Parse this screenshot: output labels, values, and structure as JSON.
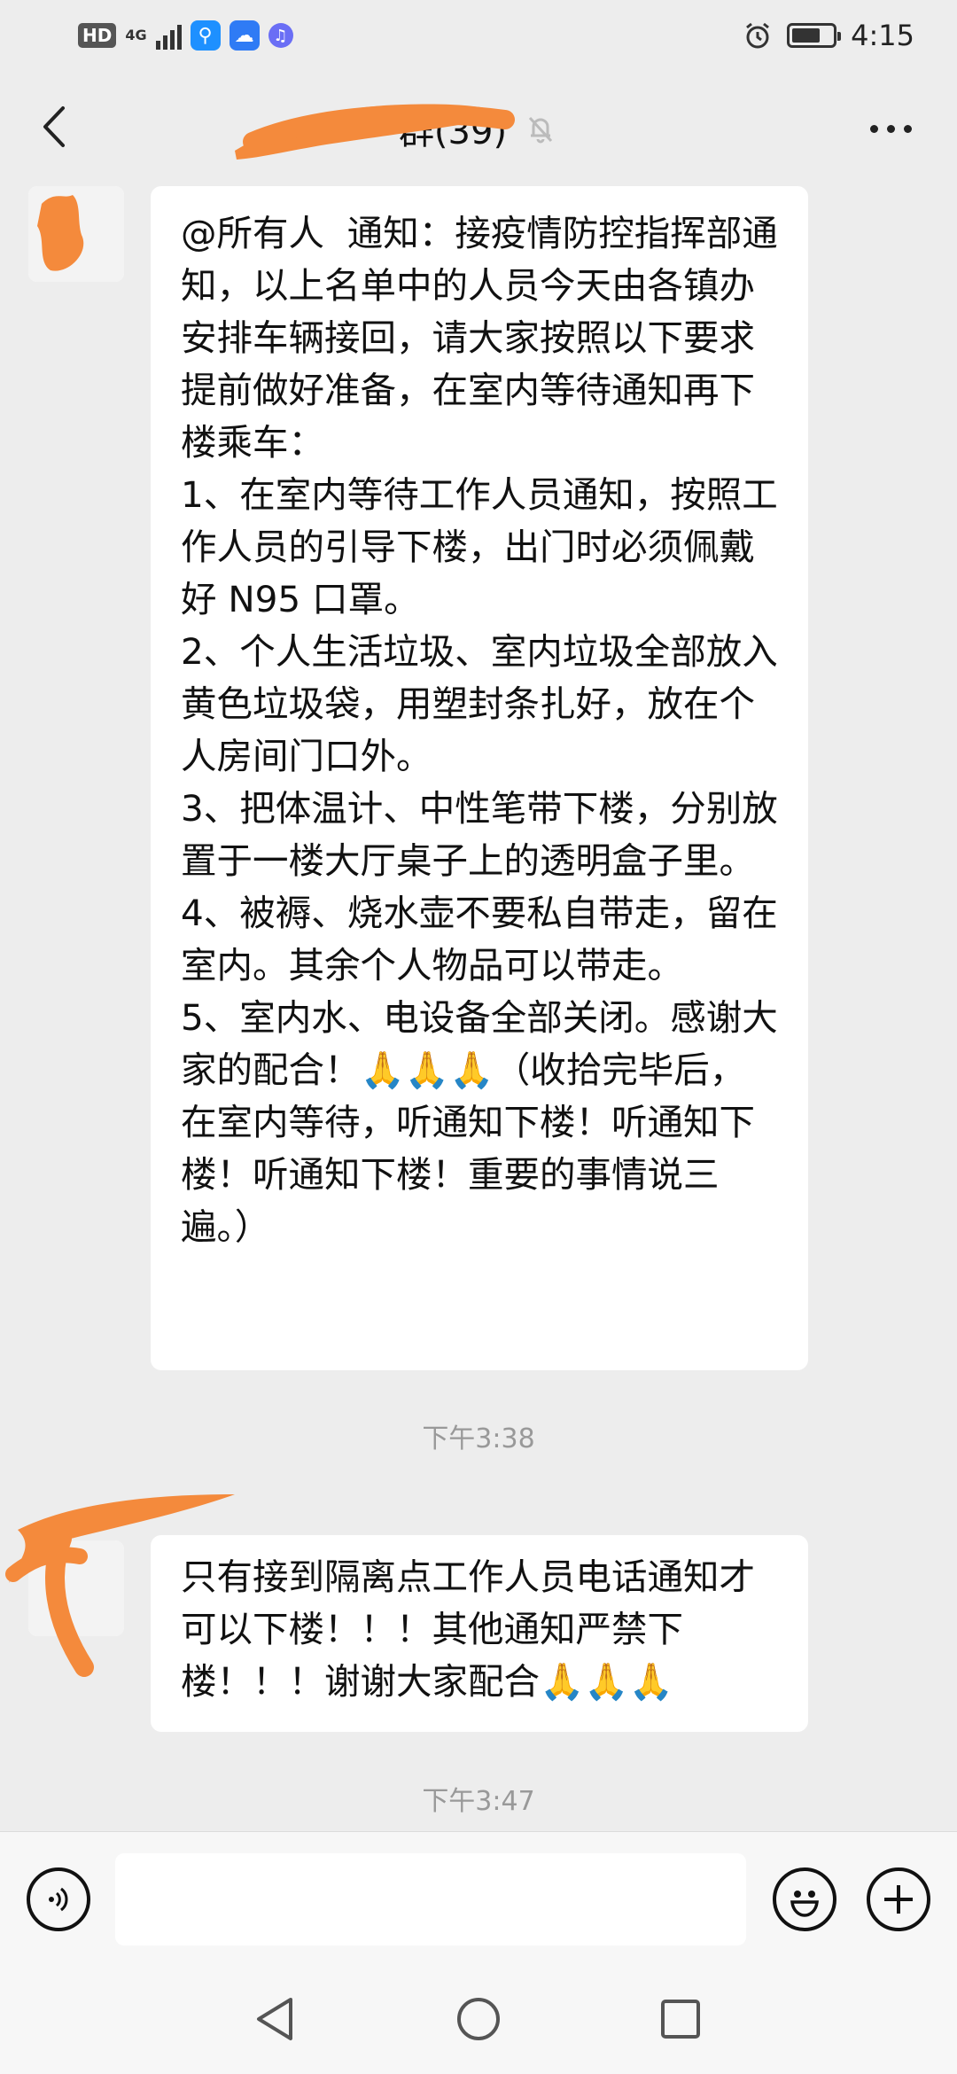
{
  "status_bar": {
    "hd_label": "HD",
    "network_label": "4G",
    "time": "4:15"
  },
  "header": {
    "title": "群(39)",
    "mute_icon": "bell-off-icon"
  },
  "messages": [
    {
      "text": "@所有人  通知：接疫情防控指挥部通知，以上名单中的人员今天由各镇办安排车辆接回，请大家按照以下要求提前做好准备，在室内等待通知再下楼乘车：\n1、在室内等待工作人员通知，按照工作人员的引导下楼，出门时必须佩戴好 N95 口罩。\n2、个人生活垃圾、室内垃圾全部放入黄色垃圾袋，用塑封条扎好，放在个人房间门口外。\n3、把体温计、中性笔带下楼，分别放置于一楼大厅桌子上的透明盒子里。\n4、被褥、烧水壶不要私自带走，留在室内。其余个人物品可以带走。\n5、室内水、电设备全部关闭。感谢大家的配合！🙏🙏🙏（收拾完毕后，在室内等待，听通知下楼！听通知下楼！听通知下楼！重要的事情说三遍。）"
    },
    {
      "text": "只有接到隔离点工作人员电话通知才可以下楼！！！其他通知严禁下楼！！！谢谢大家配合🙏🙏🙏"
    }
  ],
  "timestamps": [
    "下午3:38",
    "下午3:47"
  ],
  "input": {
    "placeholder": "",
    "value": "",
    "voice_icon": "voice-icon",
    "emoji_icon": "emoji-icon",
    "plus_icon": "plus-icon"
  },
  "nav": {
    "back_icon": "triangle-back-icon",
    "home_icon": "circle-home-icon",
    "recents_icon": "square-recents-icon"
  },
  "colors": {
    "background": "#ededed",
    "bubble": "#ffffff",
    "scribble": "#f48a3c"
  }
}
